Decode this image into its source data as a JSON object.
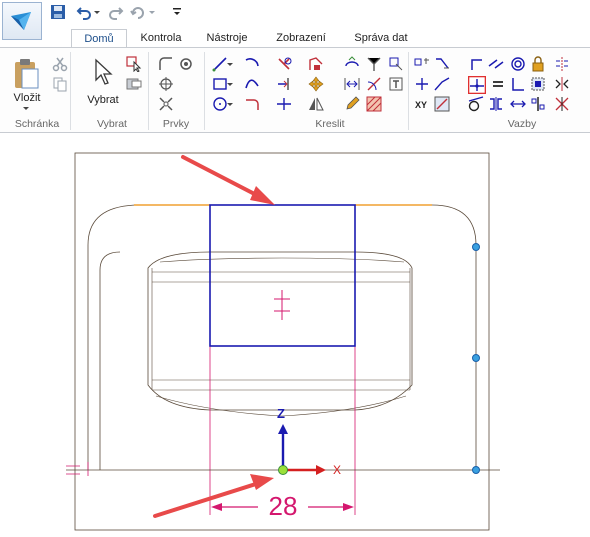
{
  "ribbon_tabs": [
    {
      "label": "Domů",
      "active": true
    },
    {
      "label": "Kontrola",
      "active": false
    },
    {
      "label": "Nástroje",
      "active": false
    },
    {
      "label": "Zobrazení",
      "active": false
    },
    {
      "label": "Správa dat",
      "active": false
    }
  ],
  "groups": {
    "clipboard": {
      "label": "Schránka",
      "paste_label": "Vložit"
    },
    "select": {
      "label": "Vybrat",
      "select_label": "Vybrat"
    },
    "features": {
      "label": "Prvky"
    },
    "draw": {
      "label": "Kreslit"
    },
    "relations": {
      "label": "Vazby"
    }
  },
  "sketch": {
    "axis_z_label": "Z",
    "axis_x_label": "X",
    "dimension_value": "28"
  },
  "colors": {
    "accent": "#1c4e8a",
    "annotation_arrow": "#e84a4a",
    "sketch_outline": "#5a4a3a",
    "selection_blue": "#1a1ab0",
    "dimension_magenta": "#d4176e",
    "highlight_orange": "#f0a030",
    "node_cyan": "#3aa0e0"
  }
}
